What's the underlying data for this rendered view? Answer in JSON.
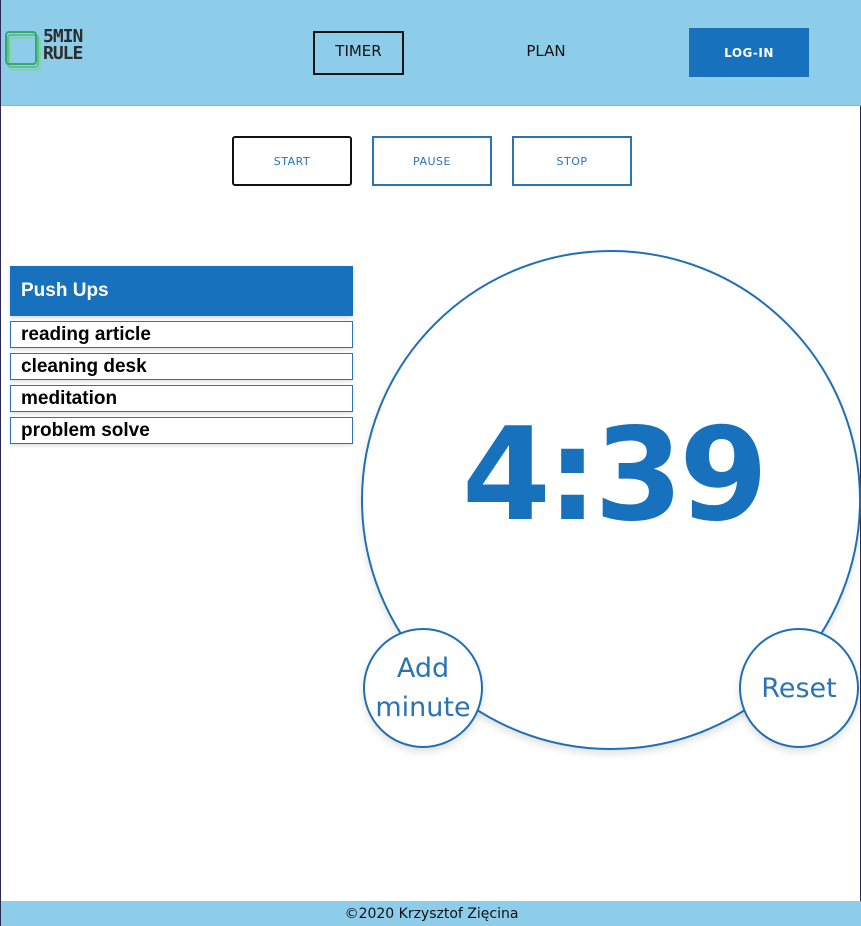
{
  "header": {
    "logo": {
      "line1": "5MIN",
      "line2": "RULE",
      "icon": "stacked-squares-icon"
    },
    "nav": [
      {
        "label": "TIMER",
        "active": true
      },
      {
        "label": "PLAN",
        "active": false
      }
    ],
    "login_label": "LOG-IN"
  },
  "controls": {
    "start": "START",
    "pause": "PAUSE",
    "stop": "STOP"
  },
  "tasks": {
    "current": "Push Ups",
    "items": [
      "reading article",
      "cleaning desk",
      "meditation",
      "problem solve"
    ]
  },
  "timer": {
    "time": "4:39",
    "add_label_line1": "Add",
    "add_label_line2": "minute",
    "reset_label": "Reset"
  },
  "footer": {
    "text": "©2020 Krzysztof Zięcina"
  },
  "colors": {
    "header_bg": "#8ecdea",
    "accent": "#1771bd",
    "outline": "#2b73b5"
  }
}
